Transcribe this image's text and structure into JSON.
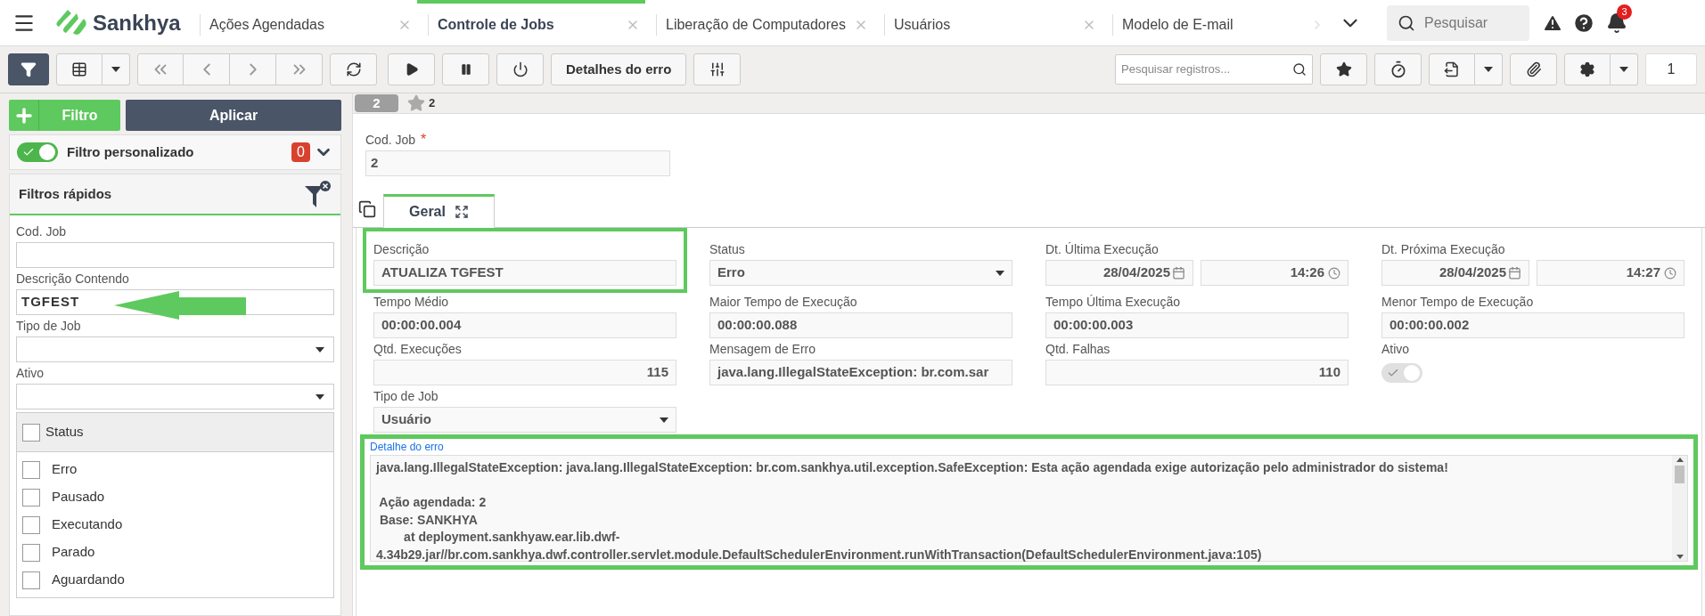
{
  "top_bar": {
    "brand": "Sankhya",
    "tabs": [
      {
        "label": "Ações Agendadas",
        "selected": false,
        "closable": true
      },
      {
        "label": "Controle de Jobs",
        "selected": true,
        "closable": true
      },
      {
        "label": "Liberação de Computadores",
        "selected": false,
        "closable": true
      },
      {
        "label": "Usuários",
        "selected": false,
        "closable": true
      },
      {
        "label": "Modelo de E-mail",
        "selected": false,
        "closable": false
      }
    ],
    "search": {
      "placeholder": "Pesquisar"
    },
    "notification_count": "3"
  },
  "toolbar": {
    "filter_selected": true,
    "error_button": "Detalhes do erro",
    "search": {
      "placeholder": "Pesquisar registros..."
    },
    "page": "1"
  },
  "filter_panel": {
    "add_button": "Filtro",
    "apply_button": "Aplicar",
    "custom_filter": {
      "label": "Filtro personalizado",
      "on": true,
      "count": "0"
    },
    "quick_filters": {
      "title": "Filtros rápidos",
      "fields": [
        {
          "kind": "text",
          "label": "Cod. Job"
        },
        {
          "kind": "text",
          "label": "Descrição Contendo",
          "value": "TGFEST",
          "arrow": true
        },
        {
          "kind": "select",
          "label": "Tipo de Job"
        },
        {
          "kind": "select",
          "label": "Ativo"
        }
      ],
      "status": {
        "label": "Status",
        "checked": false,
        "options": [
          {
            "label": "Erro",
            "checked": false
          },
          {
            "label": "Pausado",
            "checked": false
          },
          {
            "label": "Executando",
            "checked": false
          },
          {
            "label": "Parado",
            "checked": false
          },
          {
            "label": "Aguardando",
            "checked": false
          }
        ]
      }
    }
  },
  "record_bar": {
    "record": "2",
    "favorite_label": "2"
  },
  "form": {
    "cod_job": {
      "label": "Cod. Job",
      "required_mark": "*",
      "value": "2"
    },
    "tabs": [
      {
        "label": "Geral",
        "selected": true
      }
    ],
    "fields": [
      {
        "kind": "text",
        "label": "Descrição",
        "value": "ATUALIZA TGFEST",
        "highlighted": true
      },
      {
        "kind": "select",
        "label": "Status",
        "value": "Erro"
      },
      {
        "kind": "datetime",
        "label": "Dt. Última Execução",
        "date": "28/04/2025",
        "time": "14:26"
      },
      {
        "kind": "datetime",
        "label": "Dt. Próxima Execução",
        "date": "28/04/2025",
        "time": "14:27"
      },
      {
        "kind": "text",
        "label": "Tempo Médio",
        "value": "00:00:00.004"
      },
      {
        "kind": "text",
        "label": "Maior Tempo de Execução",
        "value": "00:00:00.088"
      },
      {
        "kind": "text",
        "label": "Tempo Última Execução",
        "value": "00:00:00.003"
      },
      {
        "kind": "text",
        "label": "Menor Tempo de Execução",
        "value": "00:00:00.002"
      },
      {
        "kind": "number",
        "label": "Qtd. Execuções",
        "value": "115"
      },
      {
        "kind": "text",
        "label": "Mensagem de Erro",
        "value": "java.lang.IllegalStateException: br.com.sar"
      },
      {
        "kind": "number",
        "label": "Qtd. Falhas",
        "value": "110"
      },
      {
        "kind": "toggle",
        "label": "Ativo",
        "on": true,
        "disabled": true
      },
      {
        "kind": "select",
        "label": "Tipo de Job",
        "value": "Usuário"
      }
    ],
    "error_detail": {
      "label": "Detalhe do erro",
      "highlighted": true,
      "text": "java.lang.IllegalStateException: java.lang.IllegalStateException: br.com.sankhya.util.exception.SafeException: Esta ação agendada exige autorização pelo administrador do sistema!\n\n Ação agendada: 2\n Base: SANKHYA\n        at deployment.sankhyaw.ear.lib.dwf-\n4.34b29.jar//br.com.sankhya.dwf.controller.servlet.module.DefaultSchedulerEnvironment.runWithTransaction(DefaultSchedulerEnvironment.java:105)"
    }
  }
}
